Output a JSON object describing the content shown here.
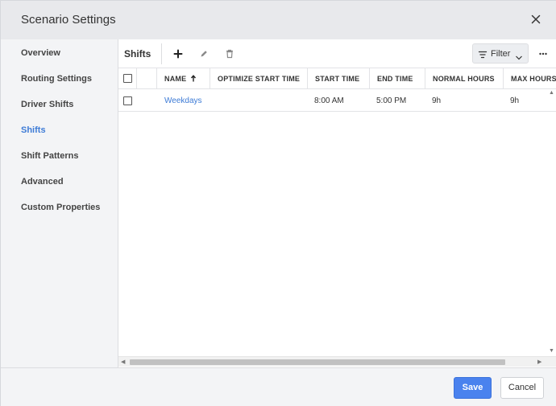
{
  "dialog": {
    "title": "Scenario Settings",
    "close_icon": "close-icon"
  },
  "sidebar": {
    "items": [
      {
        "label": "Overview",
        "active": false
      },
      {
        "label": "Routing Settings",
        "active": false
      },
      {
        "label": "Driver Shifts",
        "active": false
      },
      {
        "label": "Shifts",
        "active": true
      },
      {
        "label": "Shift Patterns",
        "active": false
      },
      {
        "label": "Advanced",
        "active": false
      },
      {
        "label": "Custom Properties",
        "active": false
      }
    ]
  },
  "toolbar": {
    "title": "Shifts",
    "add_icon": "plus-icon",
    "edit_icon": "pencil-icon",
    "delete_icon": "trash-icon",
    "filter_label": "Filter",
    "filter_icon": "filter-icon",
    "more_icon": "more-horizontal-icon"
  },
  "table": {
    "columns": [
      "NAME",
      "OPTIMIZE START TIME",
      "START TIME",
      "END TIME",
      "NORMAL HOURS",
      "MAX HOURS"
    ],
    "sort": {
      "column": "NAME",
      "direction": "ascending",
      "icon": "arrow-up-icon"
    },
    "rows": [
      {
        "name": "Weekdays",
        "optimize_start_time": "",
        "start_time": "8:00 AM",
        "end_time": "5:00 PM",
        "normal_hours": "9h",
        "max_hours": "9h"
      }
    ]
  },
  "footer": {
    "save_label": "Save",
    "cancel_label": "Cancel"
  },
  "colors": {
    "accent": "#3d7bd6",
    "save_button": "#4a82ee"
  }
}
